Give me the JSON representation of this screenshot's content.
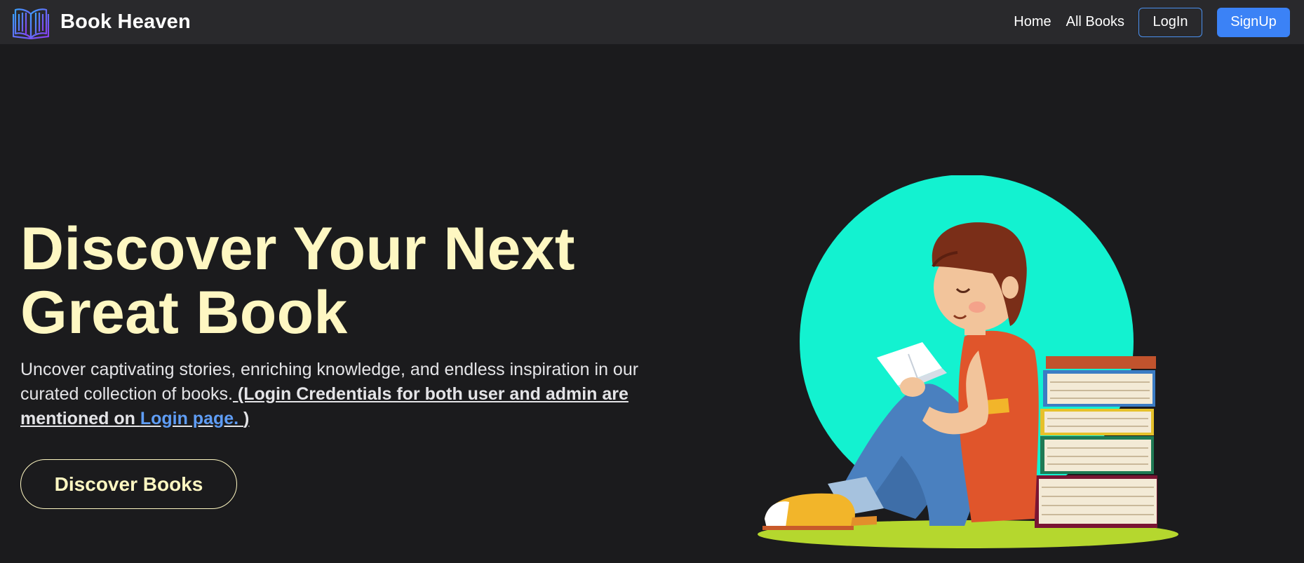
{
  "brand": {
    "name": "Book Heaven",
    "logo_icon": "open-book-icon"
  },
  "nav": {
    "home": "Home",
    "all_books": "All Books",
    "login": "LogIn",
    "signup": "SignUp"
  },
  "hero": {
    "title_line1": "Discover Your Next",
    "title_line2": "Great Book",
    "description": "Uncover captivating stories, enriching knowledge, and endless inspiration in our curated collection of books.",
    "credentials_note": " (Login Credentials for both user and admin are mentioned on ",
    "credentials_link": "Login page. ",
    "credentials_close": ")",
    "button": "Discover Books",
    "illustration": "boy-reading-book-illustration"
  },
  "colors": {
    "background": "#1b1b1d",
    "navbar": "#29292c",
    "accent_yellow": "#fef7c2",
    "primary_blue": "#3b82f6",
    "link_blue": "#5f9df5",
    "circle_teal": "#13f2d0"
  }
}
